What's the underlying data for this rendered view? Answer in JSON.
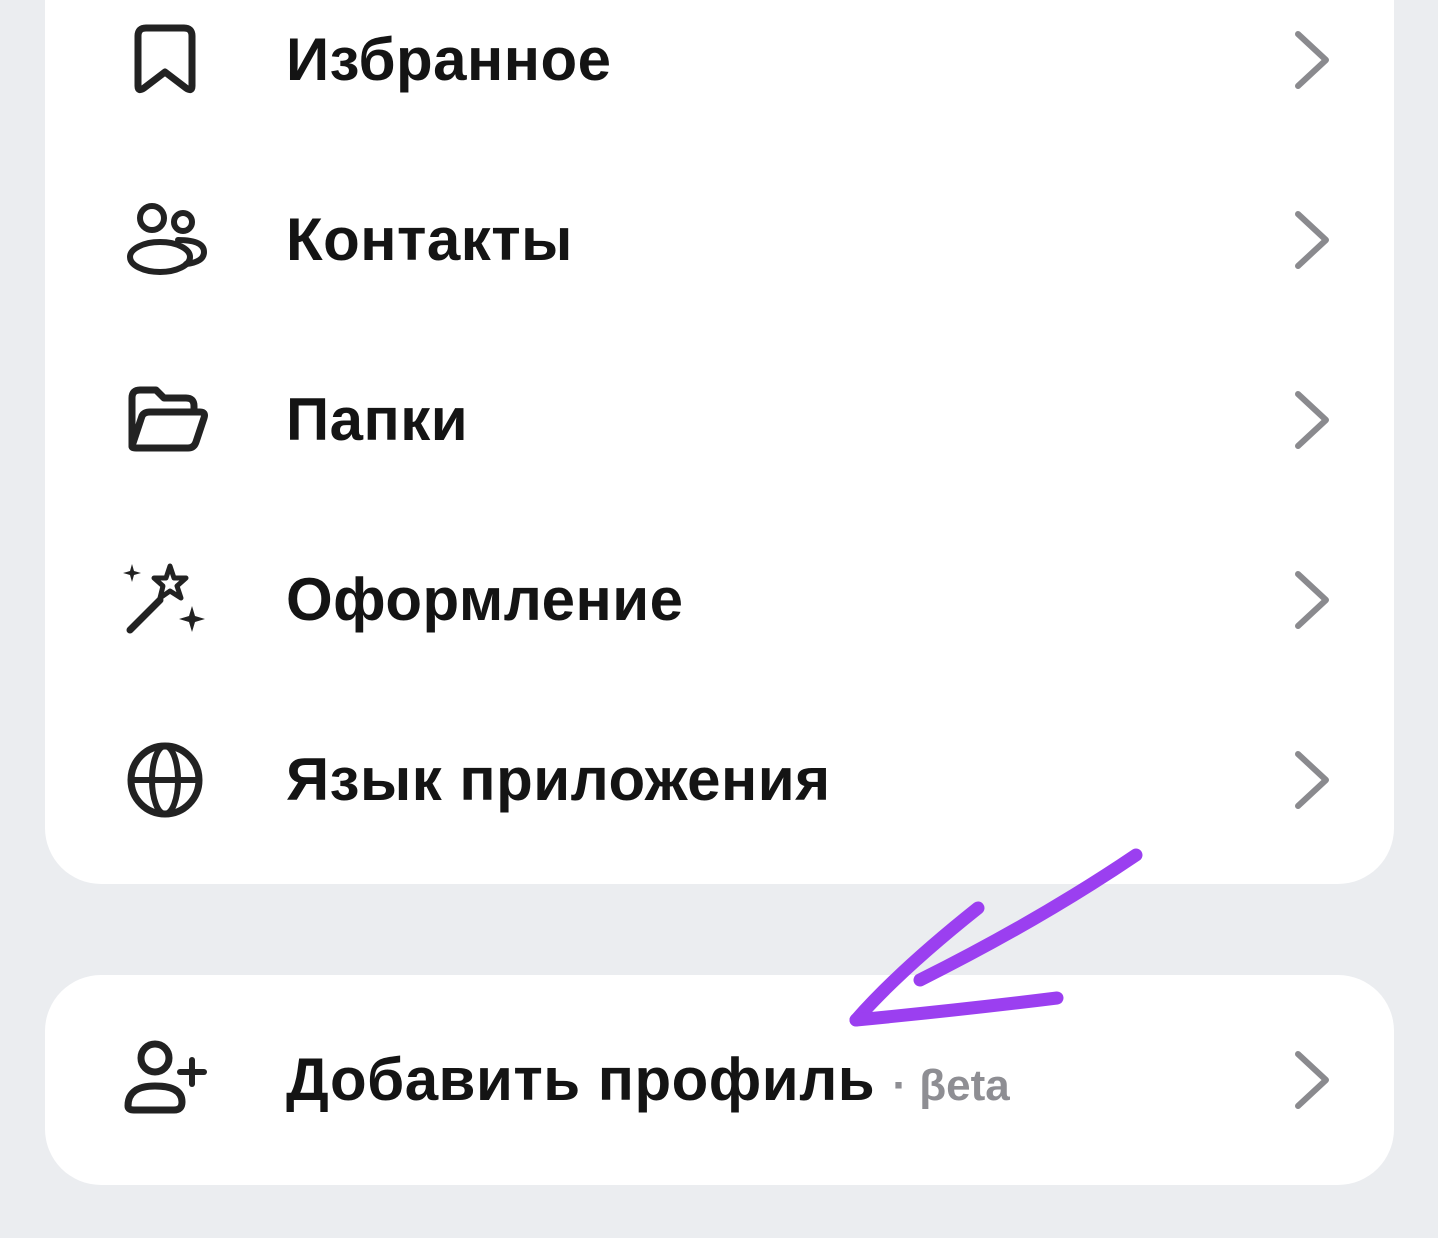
{
  "menu": {
    "items": [
      {
        "label": "Избранное",
        "icon": "bookmark-icon"
      },
      {
        "label": "Контакты",
        "icon": "contacts-icon"
      },
      {
        "label": "Папки",
        "icon": "folder-icon"
      },
      {
        "label": "Оформление",
        "icon": "magic-wand-icon"
      },
      {
        "label": "Язык приложения",
        "icon": "globe-icon"
      }
    ]
  },
  "profile": {
    "add_label": "Добавить профиль",
    "badge": "· βeta",
    "icon": "add-user-icon"
  },
  "annotation": {
    "arrow_color": "#9b3ff0"
  },
  "colors": {
    "background": "#ebedf0",
    "card": "#ffffff",
    "text": "#141414",
    "chevron": "#8a8a8e",
    "badge": "#8e8e93",
    "icon": "#222222"
  }
}
